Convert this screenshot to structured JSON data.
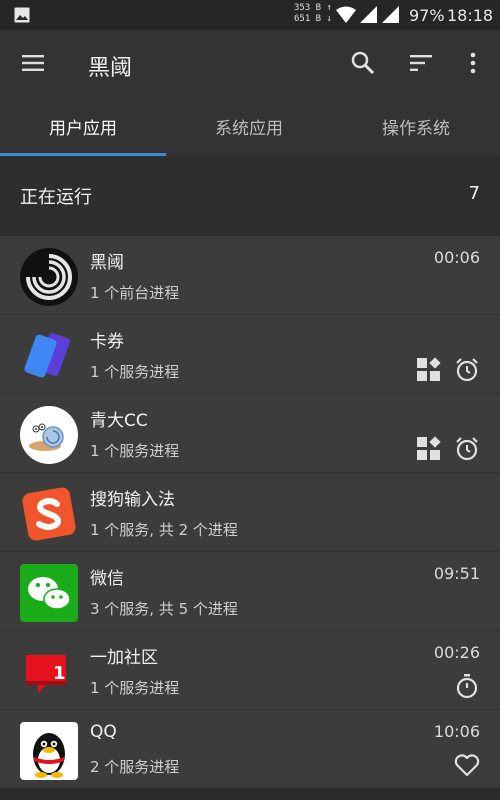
{
  "status_bar": {
    "speed_up": "353 B ↑",
    "speed_down": "651 B ↓",
    "battery": "97%",
    "time": "18:18"
  },
  "toolbar": {
    "title": "黑阈",
    "icons": [
      "menu-icon",
      "search-icon",
      "sort-icon",
      "more-vert-icon"
    ]
  },
  "tabs": [
    {
      "label": "用户应用"
    },
    {
      "label": "系统应用"
    },
    {
      "label": "操作系统"
    }
  ],
  "section": {
    "label": "正在运行",
    "count": "7"
  },
  "apps": [
    {
      "name": "黑阈",
      "sub": "1 个前台进程",
      "time": "00:06"
    },
    {
      "name": "卡券",
      "sub": "1 个服务进程",
      "time": ""
    },
    {
      "name": "青大CC",
      "sub": "1 个服务进程",
      "time": ""
    },
    {
      "name": "搜狗输入法",
      "sub": "1 个服务, 共 2 个进程",
      "time": ""
    },
    {
      "name": "微信",
      "sub": "3 个服务, 共 5 个进程",
      "time": "09:51"
    },
    {
      "name": "一加社区",
      "sub": "1 个服务进程",
      "time": "00:26"
    },
    {
      "name": "QQ",
      "sub": "2 个服务进程",
      "time": "10:06"
    }
  ],
  "colors": {
    "accent": "#3d8cdb",
    "background": "#2b2b2b",
    "row": "#3c3c3c"
  }
}
